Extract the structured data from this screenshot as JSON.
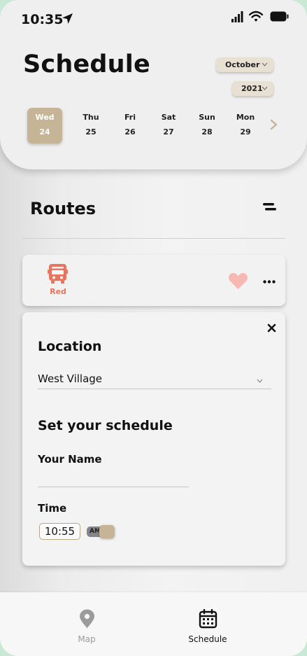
{
  "status_bar": {
    "time": "10:35"
  },
  "header": {
    "title": "Schedule",
    "month": "October",
    "year": "2021",
    "days": [
      {
        "name": "Wed",
        "num": "24",
        "selected": true
      },
      {
        "name": "Thu",
        "num": "25"
      },
      {
        "name": "Fri",
        "num": "26"
      },
      {
        "name": "Sat",
        "num": "27"
      },
      {
        "name": "Sun",
        "num": "28"
      },
      {
        "name": "Mon",
        "num": "29"
      }
    ]
  },
  "routes": {
    "title": "Routes",
    "route": {
      "name": "Red"
    }
  },
  "form": {
    "location_label": "Location",
    "location_value": "West Village",
    "schedule_heading": "Set your schedule",
    "name_label": "Your Name",
    "name_value": "",
    "time_label": "Time",
    "time_value": "10:55",
    "ampm": "AM"
  },
  "nav": {
    "map_label": "Map",
    "schedule_label": "Schedule"
  },
  "colors": {
    "accent": "#c6b497",
    "route_red": "#e8755f",
    "heart": "#f7b8b4"
  }
}
